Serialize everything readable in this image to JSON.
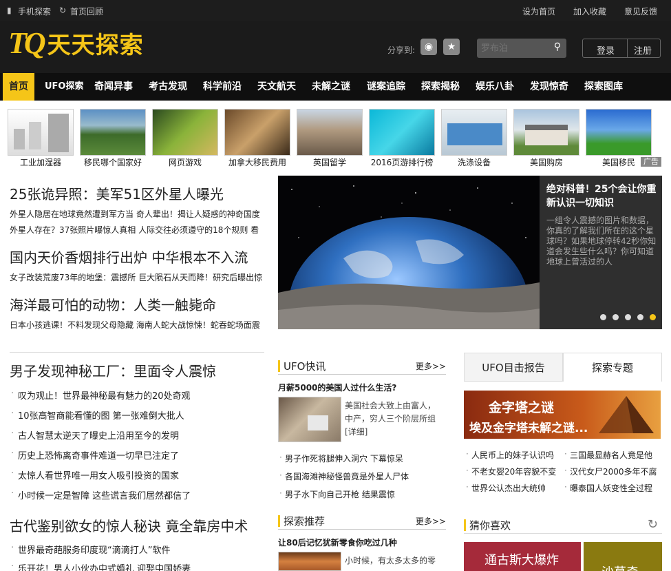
{
  "topbar": {
    "mobile": "手机探索",
    "back": "首页回顾",
    "set_home": "设为首页",
    "favorite": "加入收藏",
    "feedback": "意见反馈"
  },
  "header": {
    "logo_mark": "TQ",
    "logo_text": "天天探索",
    "share_label": "分享到:",
    "search_placeholder": "罗布泊",
    "login": "登录",
    "register": "注册"
  },
  "nav": [
    "首页",
    "UFO探索",
    "奇闻异事",
    "考古发现",
    "科学前沿",
    "天文航天",
    "未解之谜",
    "谜案追踪",
    "探索揭秘",
    "娱乐八卦",
    "发现惊奇",
    "探索图库"
  ],
  "thumbs": [
    "工业加湿器",
    "移民哪个国家好",
    "网页游戏",
    "加拿大移民费用",
    "英国留学",
    "2016页游排行榜",
    "洗涤设备",
    "美国购房",
    "美国移民"
  ],
  "ad_label": "广告",
  "headlines": [
    {
      "title": "25张诡异照：美军51区外星人曝光",
      "subs": [
        "外星人隐居在地球竟然遭到军方当  奇人辈出！揭让人疑惑的神奇国度",
        "外星人存在？37张照片曝惊人真相  人际交往必须遵守的18个规则  看"
      ]
    },
    {
      "title": "国内天价香烟排行出炉 中华根本不入流",
      "subs": [
        "女子改装荒废73年的地堡：震撼所  巨大陨石从天而降！研究后曝出惊"
      ]
    },
    {
      "title": "海洋最可怕的动物：人类一触毙命",
      "subs": [
        "日本小孩逃课！不料发现父母隐藏  海南人蛇大战惊悚！蛇吞蛇场面震"
      ]
    }
  ],
  "hero": {
    "title": "绝对科普！25个会让你重新认识一切知识",
    "desc": "一组令人震撼的图片和数据，你真的了解我们所在的这个星球吗？如果地球停转42秒你知道会发生些什么吗？你可知道地球上曾活过的人"
  },
  "left_list": {
    "title1": "男子发现神秘工厂：里面令人震惊",
    "items1": [
      "叹为观止！世界最神秘最有魅力的20处奇观",
      "10张高智商能看懂的图 第一张难倒大批人",
      "古人智慧太逆天了曝史上沿用至今的发明",
      "历史上恐怖离奇事件难道一切早已注定了",
      "太惊人看世界唯一用女人吸引投资的国家",
      "小时候一定是智障 这些谎言我们居然都信了"
    ],
    "title2": "古代鉴别欲女的惊人秘诀 竟全靠房中术",
    "items2": [
      "世界最奇葩服务印度现“滴滴打人”软件",
      "乐开花！男人小伙办中式婚礼 迎娶中国娇妻"
    ]
  },
  "ufo": {
    "title": "UFO快讯",
    "more": "更多>>",
    "feature_title": "月薪5000的美国人过什么生活?",
    "feature_desc": "美国社会大致上由富人，中产，穷人三个阶层所组",
    "feature_link": "[详细]",
    "items": [
      "男子作死将腿伸入洞穴 下幕惊呆",
      "各国海滩神秘怪兽竟是外星人尸体",
      "男子水下向自己开枪 结果震惊"
    ]
  },
  "tuijian": {
    "title": "探索推荐",
    "more": "更多>>",
    "feature_title": "让80后记忆犹新零食你吃过几种",
    "feature_desc": "小时候，有太多太多的零"
  },
  "right": {
    "tab1": "UFO目击报告",
    "tab2": "探索专题",
    "banner_line1": "金字塔之谜",
    "banner_line2": "埃及金字塔未解之谜...",
    "items_left": [
      "人民币上的妹子认识吗",
      "不老女婴20年容貌不变",
      "世界公认杰出大统帅"
    ],
    "items_right": [
      "三国最显赫名人竟是他",
      "汉代女尸2000多年不腐",
      "曝泰国人妖变性全过程"
    ],
    "guess_title": "猜你喜欢",
    "card1": "通古斯大爆炸",
    "card2": "沙草奇"
  }
}
